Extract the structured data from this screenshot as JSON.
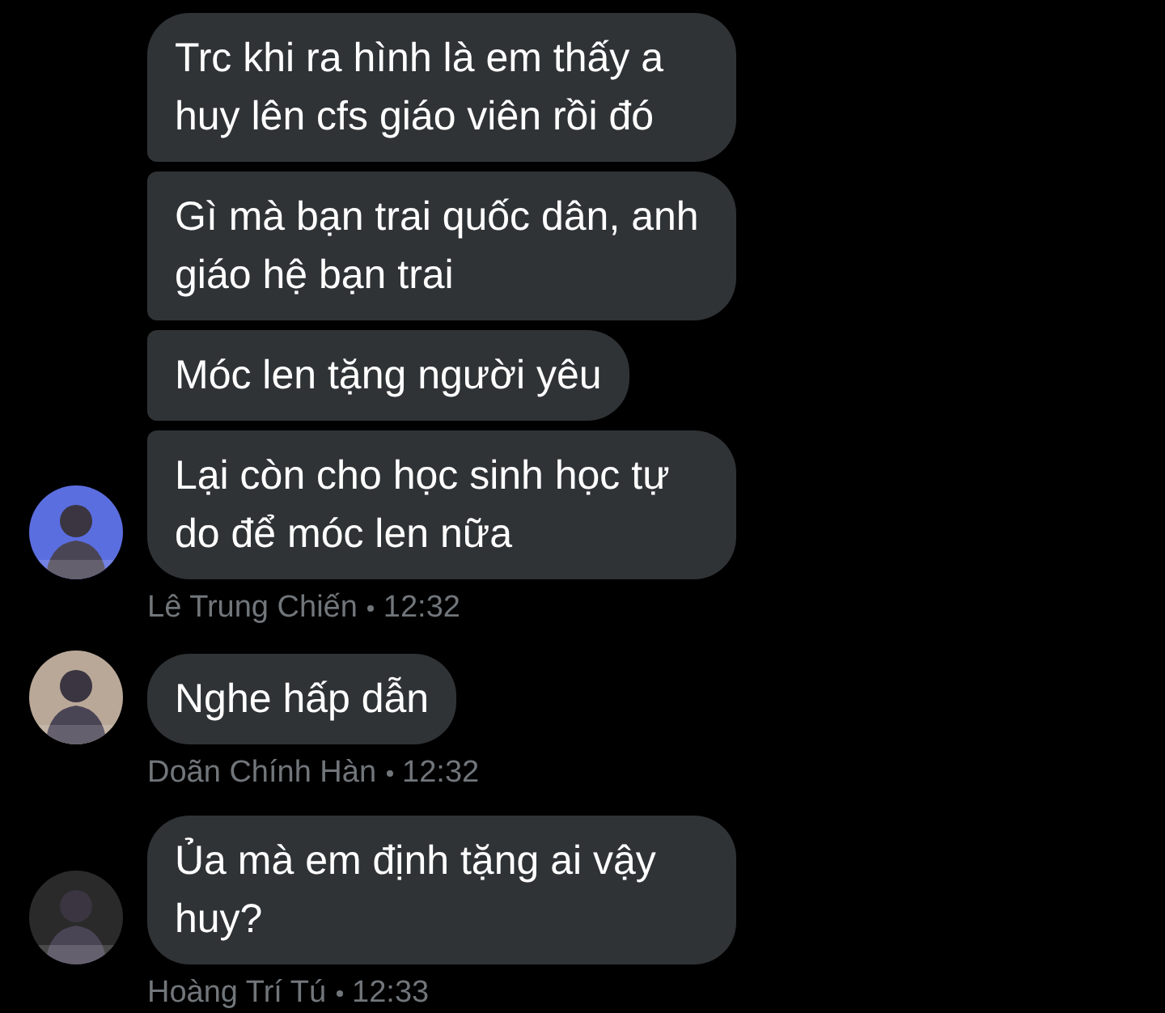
{
  "groups": [
    {
      "messages": [
        "Trc khi ra hình là em thấy a huy lên cfs giáo viên rồi đó",
        "Gì mà bạn trai quốc dân, anh giáo hệ bạn trai",
        "Móc len tặng người yêu",
        "Lại còn cho học sinh học tự do để móc len nữa"
      ],
      "sender": "Lê Trung Chiến",
      "time": "12:32"
    },
    {
      "messages": [
        "Nghe hấp dẫn"
      ],
      "sender": "Doãn Chính Hàn",
      "time": "12:32"
    },
    {
      "messages": [
        "Ủa mà em định tặng ai vậy huy?"
      ],
      "sender": "Hoàng Trí Tú",
      "time": "12:33"
    }
  ]
}
